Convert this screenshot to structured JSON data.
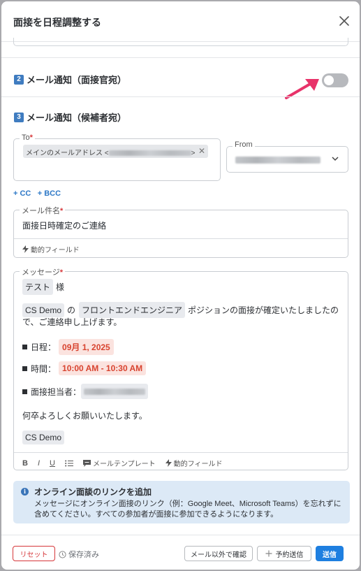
{
  "modal": {
    "title": "面接を日程調整する",
    "close_icon": "close-icon"
  },
  "section2": {
    "num": "2",
    "title": "メール通知（面接官宛）",
    "toggle_on": false
  },
  "section3": {
    "num": "3",
    "title": "メール通知（候補者宛）"
  },
  "to_field": {
    "label": "To",
    "chip_prefix": "メインのメールアドレス <",
    "chip_suffix": ">"
  },
  "from_field": {
    "label": "From"
  },
  "cc_link": "+ CC",
  "bcc_link": "+ BCC",
  "subject": {
    "label": "メール件名",
    "value": "面接日時確定のご連絡",
    "dynamic_label": "動的フィールド"
  },
  "message": {
    "label": "メッセージ",
    "candidate_var": "テスト",
    "honorific": "様",
    "company_var": "CS Demo",
    "particle": "の",
    "position_var": "フロントエンドエンジニア",
    "line2_rest": "ポジションの面接が確定いたしましたの",
    "line3": "で、ご連絡申し上げます。",
    "date_label": "日程：",
    "date_value": "09月 1, 2025",
    "time_label": "時間：",
    "time_value": "10:00 AM - 10:30 AM",
    "interviewer_label": "面接担当者：",
    "closing": "何卒よろしくお願いいたします。",
    "signature_var": "CS Demo"
  },
  "toolbar": {
    "bold": "B",
    "italic": "I",
    "underline": "U",
    "template_label": "メールテンプレート",
    "dynamic_label": "動的フィールド"
  },
  "info": {
    "title": "オンライン面談のリンクを追加",
    "body": "メッセージにオンライン面接のリンク（例：Google Meet、Microsoft Teams）を忘れずに含めてください。すべての参加者が面接に参加できるようになります。"
  },
  "footer": {
    "reset_label": "リセット",
    "saved_label": "保存済み",
    "preview_label": "メール以外で確認",
    "schedule_label": "予約送信",
    "send_label": "送信"
  },
  "colors": {
    "accent": "#1e7fe0",
    "reset": "#d6373a",
    "arrow": "#e8336a",
    "highlight": "#d8432f"
  }
}
